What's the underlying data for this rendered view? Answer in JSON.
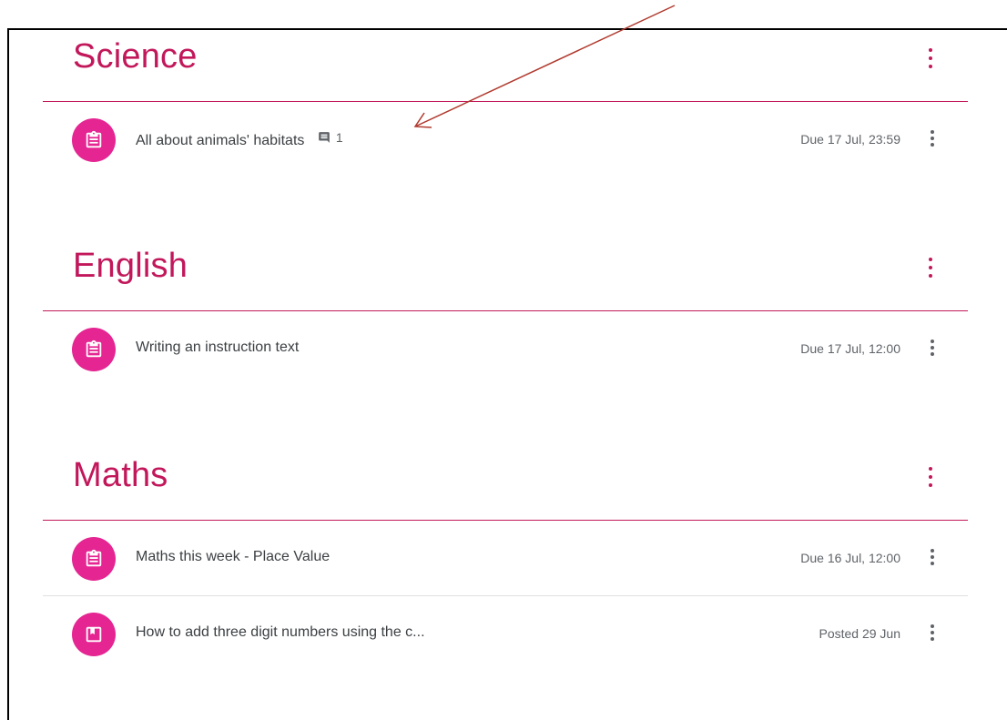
{
  "colors": {
    "accent": "#c2185b",
    "icon_bg": "#e52592",
    "divider": "#c2185b"
  },
  "topics": [
    {
      "title": "Science",
      "items": [
        {
          "title": "All about animals' habitats",
          "icon": "assignment-icon",
          "comment_icon": "comment-icon",
          "comment_count": "1",
          "date": "Due 17 Jul, 23:59"
        }
      ]
    },
    {
      "title": "English",
      "items": [
        {
          "title": "Writing an instruction text",
          "icon": "assignment-icon",
          "date": "Due 17 Jul, 12:00"
        }
      ]
    },
    {
      "title": "Maths",
      "items": [
        {
          "title": "Maths this week - Place Value",
          "icon": "assignment-icon",
          "date": "Due 16 Jul, 12:00"
        },
        {
          "title": "How to add three digit numbers using the c...",
          "icon": "material-icon",
          "date": "Posted 29 Jun"
        }
      ]
    }
  ]
}
